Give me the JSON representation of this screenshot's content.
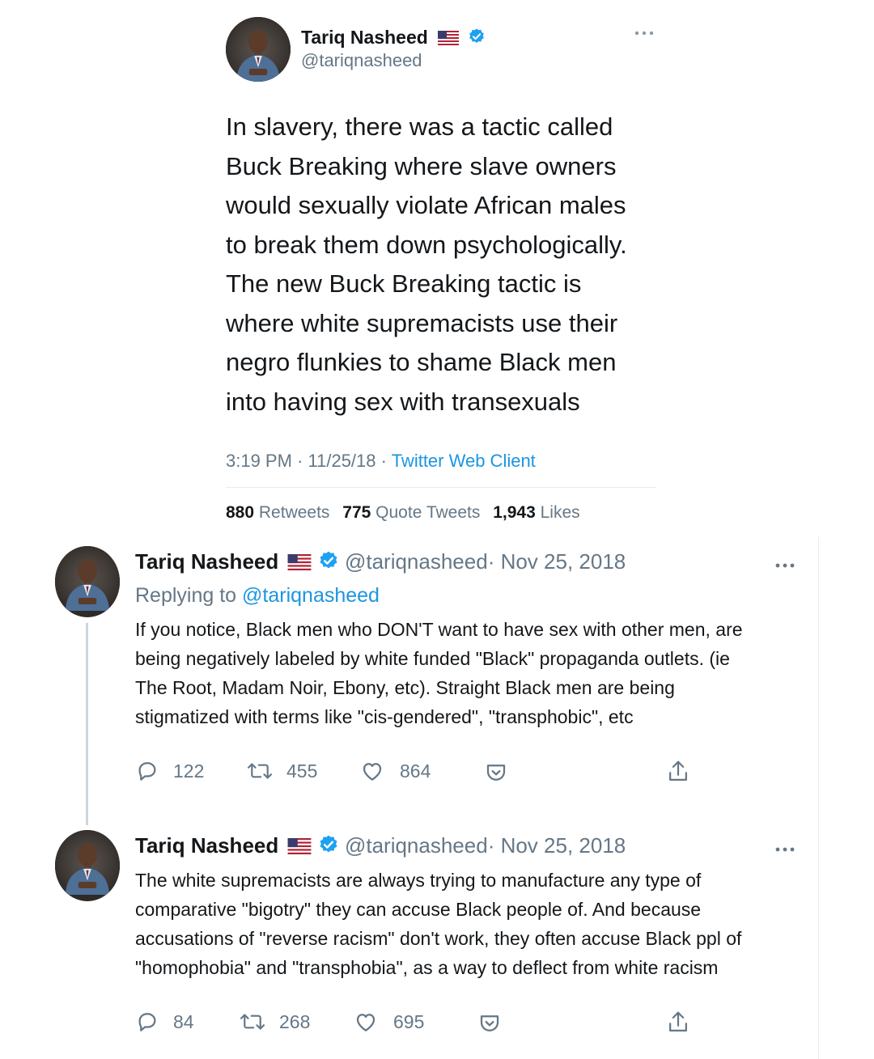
{
  "main_tweet": {
    "author_name": "Tariq Nasheed",
    "handle": "@tariqnasheed",
    "text_lines": [
      "In slavery, there was a tactic called",
      "Buck Breaking where slave owners",
      "would sexually violate African males",
      "to break them down psychologically.",
      "The new Buck Breaking tactic is",
      "where white supremacists use their",
      "negro flunkies to shame Black men",
      "into having sex with transexuals"
    ],
    "time": "3:19 PM",
    "date": "11/25/18",
    "source": "Twitter Web Client",
    "sep": "·",
    "stats": {
      "retweets_count": "880",
      "retweets_label": "Retweets",
      "quotes_count": "775",
      "quotes_label": "Quote Tweets",
      "likes_count": "1,943",
      "likes_label": "Likes"
    }
  },
  "replies": [
    {
      "author_name": "Tariq Nasheed",
      "handle": "@tariqnasheed",
      "date": "· Nov 25, 2018",
      "replying_label": "Replying to",
      "replying_handle": "@tariqnasheed",
      "text_lines": [
        "If you notice, Black men who DON'T want to have sex with other men, are",
        "being negatively labeled by white funded \"Black\" propaganda outlets. (ie",
        "The Root, Madam Noir, Ebony, etc). Straight Black men are being",
        "stigmatized with terms like \"cis-gendered\", \"transphobic\", etc"
      ],
      "replies": "122",
      "retweets": "455",
      "likes": "864"
    },
    {
      "author_name": "Tariq Nasheed",
      "handle": "@tariqnasheed",
      "date": "· Nov 25, 2018",
      "text_lines": [
        "The white supremacists are always trying to manufacture any type of",
        "comparative \"bigotry\" they can accuse Black people of. And because",
        "accusations of \"reverse racism\" don't work, they often accuse Black ppl of",
        "\"homophobia\" and \"transphobia\", as a way to deflect from white racism"
      ],
      "replies": "84",
      "retweets": "268",
      "likes": "695"
    }
  ],
  "icons": {
    "more": "more-icon",
    "verified": "verified-badge-icon",
    "flag": "us-flag-icon",
    "reply": "reply-icon",
    "retweet": "retweet-icon",
    "like": "like-icon",
    "save": "pocket-save-icon",
    "share": "share-icon"
  },
  "colors": {
    "link": "#1b95e0",
    "muted": "#657786",
    "text": "#14171a"
  }
}
